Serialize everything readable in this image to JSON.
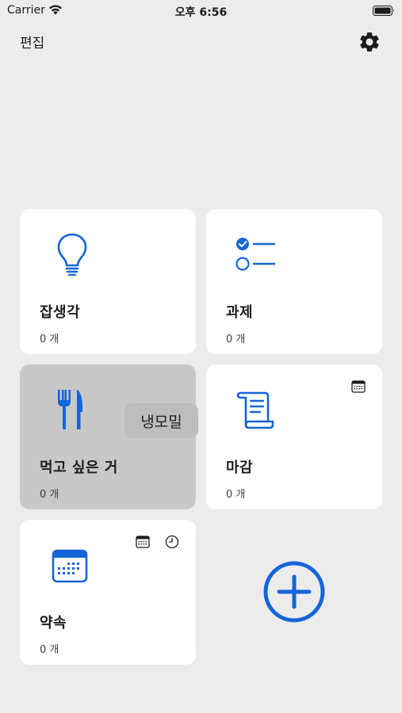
{
  "status_bar": {
    "carrier": "Carrier",
    "time": "오후 6:56"
  },
  "nav": {
    "edit_label": "편집",
    "settings_icon": "gear-icon"
  },
  "colors": {
    "accent": "#1565d8",
    "background": "#ececec",
    "card": "#ffffff",
    "card_pressed": "#c8c8c8"
  },
  "cards": [
    {
      "title": "잡생각",
      "count": "0 개",
      "icon": "lightbulb-icon"
    },
    {
      "title": "과제",
      "count": "0 개",
      "icon": "checklist-icon"
    },
    {
      "title": "먹고 싶은 거",
      "count": "0 개",
      "icon": "fork-knife-icon",
      "tooltip": "냉모밀"
    },
    {
      "title": "마감",
      "count": "0 개",
      "icon": "scroll-icon",
      "badges": [
        "calendar-icon"
      ]
    },
    {
      "title": "약속",
      "count": "0 개",
      "icon": "calendar-icon",
      "badges": [
        "calendar-icon",
        "clock-icon"
      ]
    }
  ],
  "add_button": {
    "icon": "plus-circle-icon"
  }
}
